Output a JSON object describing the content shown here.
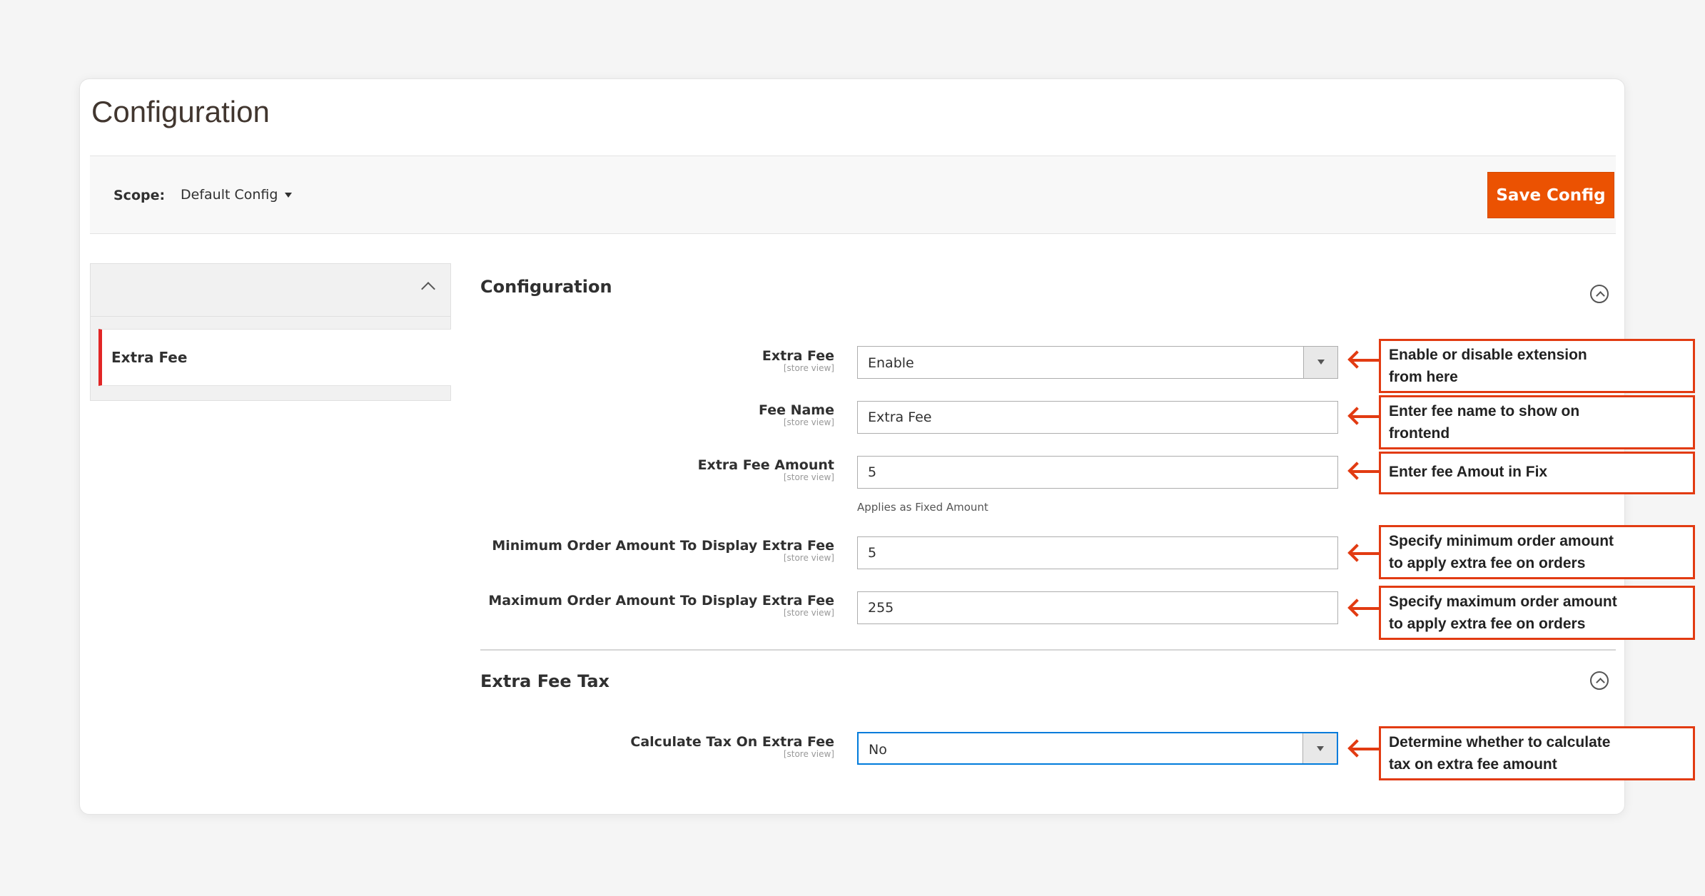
{
  "page": {
    "title": "Configuration"
  },
  "scope": {
    "label": "Scope:",
    "value": "Default Config"
  },
  "actions": {
    "save_label": "Save Config"
  },
  "sidebar": {
    "items": [
      {
        "label": "Extra Fee"
      }
    ]
  },
  "sections": {
    "configuration": {
      "title": "Configuration"
    },
    "tax": {
      "title": "Extra Fee Tax"
    }
  },
  "fields": {
    "extra_fee": {
      "label": "Extra Fee",
      "scope": "[store view]",
      "value": "Enable"
    },
    "fee_name": {
      "label": "Fee Name",
      "scope": "[store view]",
      "value": "Extra Fee"
    },
    "fee_amount": {
      "label": "Extra Fee Amount",
      "scope": "[store view]",
      "value": "5",
      "note": "Applies as Fixed Amount"
    },
    "min_order": {
      "label": "Minimum Order Amount To Display Extra Fee",
      "scope": "[store view]",
      "value": "5"
    },
    "max_order": {
      "label": "Maximum Order Amount To Display Extra Fee",
      "scope": "[store view]",
      "value": "255"
    },
    "calc_tax": {
      "label": "Calculate Tax On Extra Fee",
      "scope": "[store view]",
      "value": "No"
    }
  },
  "annotations": {
    "extra_fee": [
      "Enable or disable extension",
      "from here"
    ],
    "fee_name": [
      "Enter fee name to show on",
      "frontend"
    ],
    "fee_amount": [
      "Enter fee Amout in Fix"
    ],
    "min_order": [
      "Specify minimum order amount",
      "to apply extra fee on orders"
    ],
    "max_order": [
      "Specify maximum order amount",
      "to apply extra fee on orders"
    ],
    "calc_tax": [
      "Determine whether to calculate",
      "tax on extra fee amount"
    ]
  },
  "colors": {
    "accent": "#eb5202",
    "annotation": "#e23b12",
    "focus": "#007bdb"
  }
}
